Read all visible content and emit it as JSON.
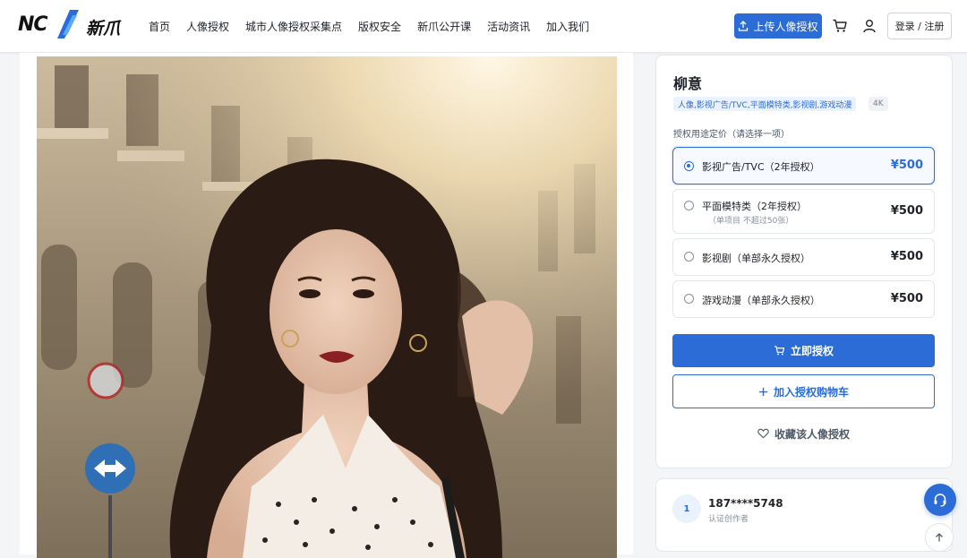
{
  "brand": {
    "logo_mark": "NC",
    "logo_text": "新爪"
  },
  "nav": {
    "items": [
      "首页",
      "人像授权",
      "城市人像授权采集点",
      "版权安全",
      "新爪公开课",
      "活动资讯",
      "加入我们"
    ]
  },
  "header": {
    "upload_label": "上传人像授权",
    "login_label": "登录 / 注册",
    "cart_icon": "cart-icon",
    "user_icon": "user-icon"
  },
  "photo": {
    "icon": "portrait-photo"
  },
  "product": {
    "name": "柳意",
    "tags": [
      "人像,影视广告/TVC,平面模特类,影视剧,游戏动漫",
      "4K"
    ],
    "price_section_label": "授权用途定价（请选择一项）",
    "options": [
      {
        "label": "影视广告/TVC（2年授权）",
        "sub": "",
        "price": "¥500",
        "selected": true
      },
      {
        "label": "平面模特类（2年授权）",
        "sub": "（单项目 不超过50张）",
        "price": "¥500",
        "selected": false
      },
      {
        "label": "影视剧（单部永久授权）",
        "sub": "",
        "price": "¥500",
        "selected": false
      },
      {
        "label": "游戏动漫（单部永久授权）",
        "sub": "",
        "price": "¥500",
        "selected": false
      }
    ],
    "buy_label": "立即授权",
    "add_cart_label": "加入授权购物车",
    "favorite_label": "收藏该人像授权"
  },
  "creator": {
    "avatar_text": "1",
    "name": "187****5748",
    "role": "认证创作者"
  },
  "colors": {
    "accent": "#2b6cd6",
    "text": "#1f2329",
    "muted": "#86909c"
  }
}
